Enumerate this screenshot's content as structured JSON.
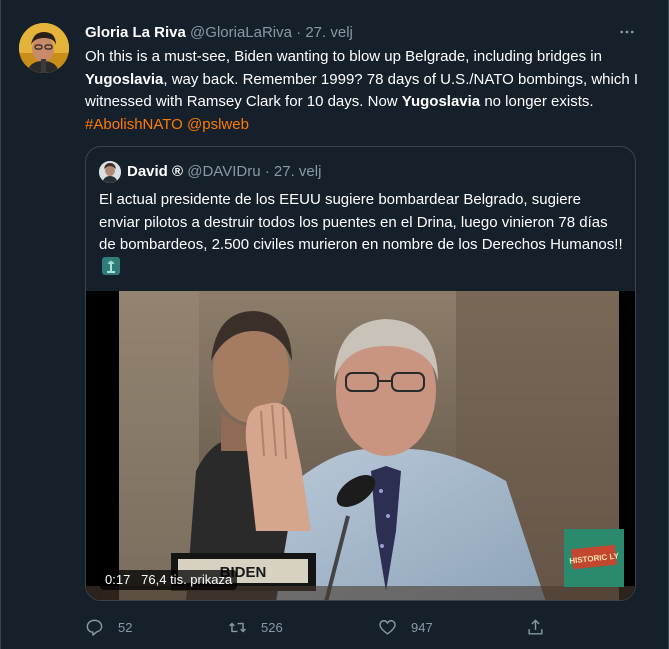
{
  "tweet": {
    "author_name": "Gloria La Riva",
    "author_handle": "@GloriaLaRiva",
    "separator": "·",
    "date": "27. velj",
    "text": {
      "p1": "Oh this is a must-see, Biden wanting to blow up Belgrade, including bridges in ",
      "b1": "Yugoslavia",
      "p2": ", way back. Remember 1999? 78 days of U.S./NATO bombings, which I witnessed with Ramsey Clark for 10 days. Now ",
      "b2": "Yugoslavia",
      "p3": " no longer exists. ",
      "hashtag": "#AbolishNATO",
      "mention": "@pslweb"
    }
  },
  "quoted": {
    "author_name": "David ®",
    "author_handle": "@DAVIDru",
    "separator": "·",
    "date": "27. velj",
    "text": "El actual presidente de los EEUU sugiere bombardear Belgrado, sugiere enviar pilotos a destruir todos los puentes en el Drina, luego vinieron 78 días de bombardeos, 2.500 civiles murieron en nombre de los Derechos Humanos!!",
    "emoji_icon": "statue-of-liberty-icon",
    "video": {
      "time": "0:17",
      "views": "76,4 tis. prikaza",
      "nameplate": "BIDEN",
      "watermark": "HISTORIC LY"
    }
  },
  "actions": {
    "reply_count": "52",
    "retweet_count": "526",
    "like_count": "947"
  },
  "colors": {
    "background": "#15202b",
    "accent": "#ff7a00",
    "muted": "#8899a6",
    "border": "#38444d"
  }
}
